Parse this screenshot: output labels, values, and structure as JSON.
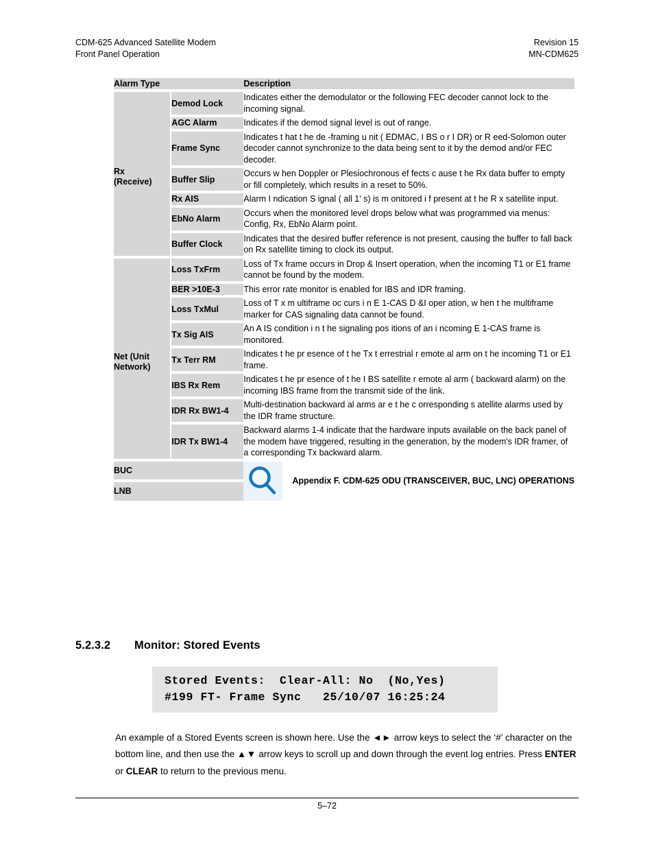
{
  "header": {
    "left_line1": "CDM-625 Advanced Satellite Modem",
    "left_line2": "Front Panel Operation",
    "right_line1": "Revision 15",
    "right_line2": "MN-CDM625"
  },
  "table": {
    "columns": {
      "alarm_type": "Alarm Type",
      "description": "Description"
    },
    "groups": [
      {
        "label_line1": "Rx",
        "label_line2": "(Receive)",
        "rows": [
          {
            "name": "Demod Lock",
            "description": "Indicates either the demodulator or the following FEC decoder cannot lock to the incoming signal."
          },
          {
            "name": "AGC Alarm",
            "description": "Indicates if the demod signal level is out of range."
          },
          {
            "name": "Frame Sync",
            "description": "Indicates t hat t he de -framing u nit ( EDMAC, I BS o r I DR) or  R eed-Solomon outer decoder cannot synchronize to the data being sent to it by the demod and/or FEC decoder."
          },
          {
            "name": "Buffer Slip",
            "description": "Occurs w hen  Doppler or   Plesiochronous ef fects c ause t he  Rx  data buffer to empty or fill completely, which results in a reset to 50%."
          },
          {
            "name": "Rx AIS",
            "description": "Alarm I ndication S ignal ( all 1' s)  is m onitored i f  present at  t he R x satellite input."
          },
          {
            "name": "EbNo Alarm",
            "description": "Occurs when the monitored level drops below what was programmed via menus: Config, Rx, EbNo Alarm point."
          },
          {
            "name": "Buffer Clock",
            "description": "Indicates that the desired buffer reference is not present, causing the buffer to fall back on Rx satellite timing to clock its output."
          }
        ]
      },
      {
        "label_line1": "Net (Unit",
        "label_line2": "Network)",
        "rows": [
          {
            "name": "Loss TxFrm",
            "description": "Loss of Tx frame occurs in Drop & Insert operation, when the incoming T1 or E1 frame cannot be found by the modem."
          },
          {
            "name": "BER >10E-3",
            "description": "This error rate monitor is enabled for IBS and IDR framing."
          },
          {
            "name": "Loss TxMul",
            "description": "Loss of  T x m ultiframe oc curs i n E 1-CAS D &I oper ation, w hen t he multiframe marker for CAS signaling data cannot be found."
          },
          {
            "name": "Tx Sig AIS",
            "description": "An A IS  condition i n t he  signaling pos itions of  an i ncoming E 1-CAS frame is monitored."
          },
          {
            "name": "Tx Terr RM",
            "description": "Indicates t he pr esence of  t he  Tx t errestrial r emote al arm on  t he incoming T1 or E1 frame."
          },
          {
            "name": "IBS Rx Rem",
            "description": "Indicates t he pr esence of  t he I BS  satellite r emote al arm ( backward alarm) on the incoming IBS frame from the transmit side of the link."
          },
          {
            "name": "IDR Rx BW1-4",
            "description": "Multi-destination  backward al arms ar e t he c orresponding s atellite alarms used by the IDR frame structure."
          },
          {
            "name": "IDR Tx BW1-4",
            "description": "Backward alarms 1-4 indicate that the hardware inputs available on the back panel of the modem have triggered, resulting in the generation, by the modem's IDR framer, of a corresponding Tx backward alarm."
          }
        ]
      }
    ],
    "odu_rows": {
      "buc_label": "BUC",
      "lnb_label": "LNB",
      "icon": "magnifying-glass-icon",
      "note": "Appendix F. CDM-625 ODU (TRANSCEIVER, BUC, LNC) OPERATIONS",
      "icon_color": "#1a75bc",
      "icon_bg": "#eaf3fa"
    }
  },
  "section": {
    "number": "5.2.3.2",
    "title": "Monitor: Stored Events"
  },
  "lcd": {
    "line1": "Stored Events:  Clear-All: No  (No,Yes)",
    "line2": "#199 FT- Frame Sync   25/10/07 16:25:24",
    "background": "#e3e3e3"
  },
  "paragraph": {
    "part1": "An example of a Stored Events screen is shown here. Use the ",
    "arrows_lr": "◄►",
    "part2": " arrow keys to select the ‘#’ character on the bottom line, and then use the ",
    "arrows_ud": "▲▼",
    "part3": " arrow keys to scroll up and down through the event log entries. Press ",
    "key_enter": "ENTER",
    "part4": " or ",
    "key_clear": "CLEAR",
    "part5": " to return to the previous menu."
  },
  "footer": {
    "page_number": "5–72"
  }
}
